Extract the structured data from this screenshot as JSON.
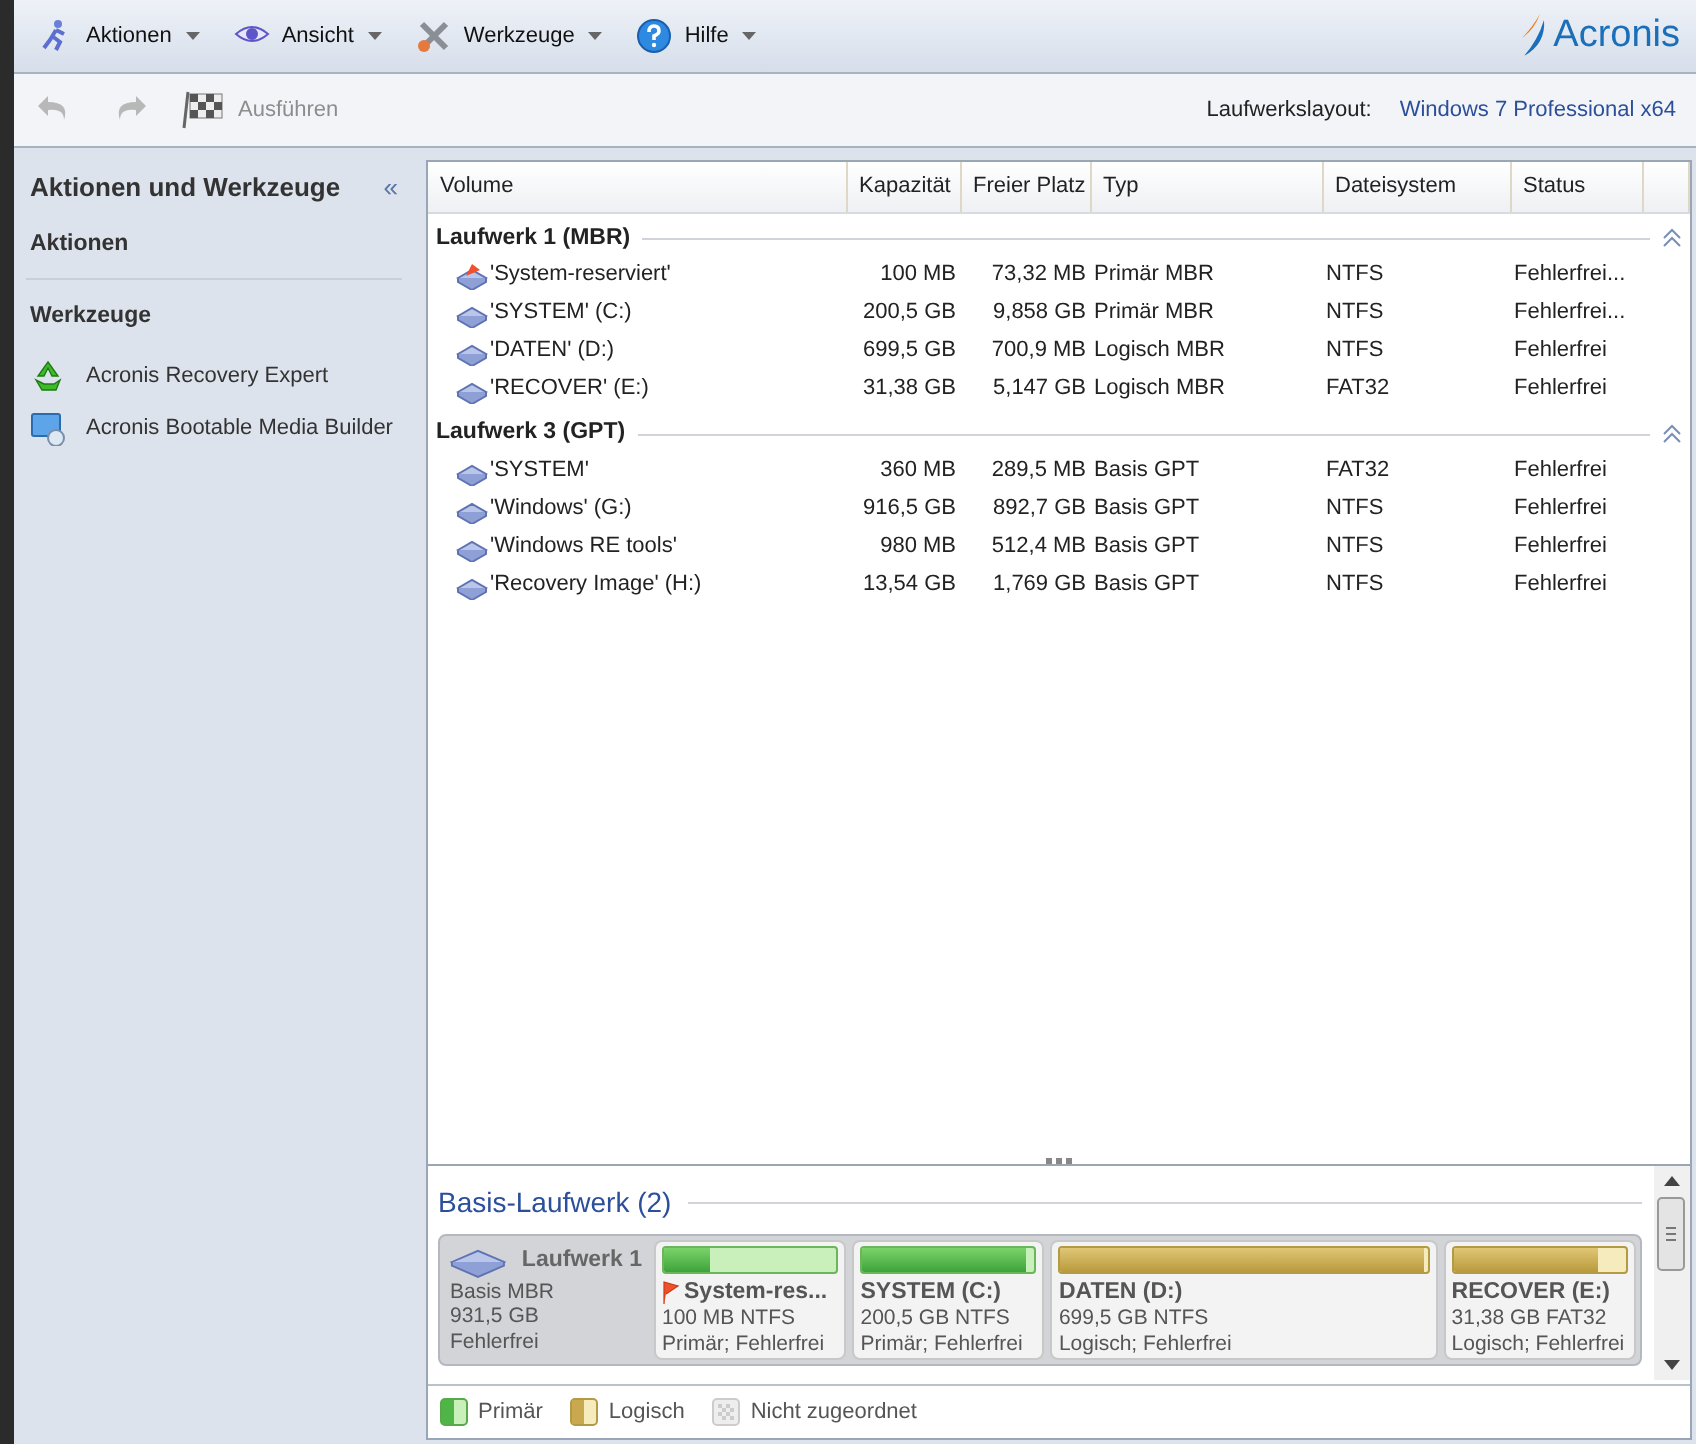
{
  "menus": [
    {
      "label": "Aktionen"
    },
    {
      "label": "Ansicht"
    },
    {
      "label": "Werkzeuge"
    },
    {
      "label": "Hilfe"
    }
  ],
  "logo": "Acronis",
  "toolbar": {
    "undo_disabled": true,
    "redo_disabled": true,
    "run": {
      "label": "Ausführen",
      "disabled": true
    },
    "layout_label": "Laufwerkslayout:",
    "layout_value": "Windows 7 Professional x64"
  },
  "sidebar": {
    "title": "Aktionen und Werkzeuge",
    "collapse": "«",
    "sections": [
      {
        "title": "Aktionen"
      },
      {
        "title": "Werkzeuge",
        "items": [
          {
            "label": "Acronis Recovery Expert"
          },
          {
            "label": "Acronis Bootable Media Builder"
          }
        ]
      }
    ]
  },
  "table": {
    "columns": [
      "Volume",
      "Kapazität",
      "Freier Platz",
      "Typ",
      "Dateisystem",
      "Status"
    ],
    "groups": [
      {
        "title": "Laufwerk 1 (MBR)",
        "expanded": true,
        "rows": [
          {
            "volume": "'System-reserviert'",
            "flag": true,
            "capacity": "100 MB",
            "free": "73,32 MB",
            "type": "Primär MBR",
            "fs": "NTFS",
            "status": "Fehlerfrei..."
          },
          {
            "volume": "'SYSTEM' (C:)",
            "flag": false,
            "capacity": "200,5 GB",
            "free": "9,858 GB",
            "type": "Primär MBR",
            "fs": "NTFS",
            "status": "Fehlerfrei..."
          },
          {
            "volume": "'DATEN' (D:)",
            "flag": false,
            "capacity": "699,5 GB",
            "free": "700,9 MB",
            "type": "Logisch MBR",
            "fs": "NTFS",
            "status": "Fehlerfrei"
          },
          {
            "volume": "'RECOVER' (E:)",
            "flag": false,
            "capacity": "31,38 GB",
            "free": "5,147 GB",
            "type": "Logisch MBR",
            "fs": "FAT32",
            "status": "Fehlerfrei"
          }
        ]
      },
      {
        "title": "Laufwerk 3 (GPT)",
        "expanded": true,
        "rows": [
          {
            "volume": "'SYSTEM'",
            "flag": false,
            "capacity": "360 MB",
            "free": "289,5 MB",
            "type": "Basis GPT",
            "fs": "FAT32",
            "status": "Fehlerfrei"
          },
          {
            "volume": "'Windows' (G:)",
            "flag": false,
            "capacity": "916,5 GB",
            "free": "892,7 GB",
            "type": "Basis GPT",
            "fs": "NTFS",
            "status": "Fehlerfrei"
          },
          {
            "volume": "'Windows RE tools'",
            "flag": false,
            "capacity": "980 MB",
            "free": "512,4 MB",
            "type": "Basis GPT",
            "fs": "NTFS",
            "status": "Fehlerfrei"
          },
          {
            "volume": "'Recovery Image' (H:)",
            "flag": false,
            "capacity": "13,54 GB",
            "free": "1,769 GB",
            "type": "Basis GPT",
            "fs": "NTFS",
            "status": "Fehlerfrei"
          }
        ]
      }
    ]
  },
  "disk_map": {
    "title": "Basis-Laufwerk (2)",
    "disk": {
      "name": "Laufwerk 1",
      "lines": [
        "Basis MBR",
        "931,5 GB",
        "Fehlerfrei"
      ]
    },
    "partitions": [
      {
        "kind": "primary",
        "flag": true,
        "name": "System-res...",
        "size": "100 MB NTFS",
        "info": "Primär; Fehlerfrei",
        "level": 0.27
      },
      {
        "kind": "primary",
        "flag": false,
        "name": "SYSTEM (C:)",
        "size": "200,5 GB NTFS",
        "info": "Primär; Fehlerfrei",
        "level": 0.95
      },
      {
        "kind": "logical",
        "flag": false,
        "name": "DATEN (D:)",
        "size": "699,5 GB NTFS",
        "info": "Logisch; Fehlerfrei",
        "level": 0.99
      },
      {
        "kind": "logical",
        "flag": false,
        "name": "RECOVER (E:)",
        "size": "31,38 GB FAT32",
        "info": "Logisch; Fehlerfrei",
        "level": 0.84
      }
    ]
  },
  "legend": [
    {
      "kind": "primary",
      "label": "Primär"
    },
    {
      "kind": "logical",
      "label": "Logisch"
    },
    {
      "kind": "unallocated",
      "label": "Nicht zugeordnet"
    }
  ]
}
